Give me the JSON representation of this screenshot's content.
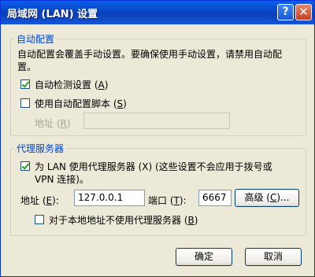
{
  "window": {
    "title": "局域网 (LAN) 设置",
    "help_glyph": "?",
    "close_glyph": "✕"
  },
  "auto_config": {
    "group_label": "自动配置",
    "description_line1": "自动配置会覆盖手动设置。要确保使用手动设置，请禁用自动配",
    "description_line2": "置。",
    "auto_detect": {
      "label": "自动检测设置 (",
      "key": "A",
      "suffix": ")",
      "checked": true
    },
    "use_script": {
      "label": "使用自动配置脚本 (",
      "key": "S",
      "suffix": ")",
      "checked": false
    },
    "address": {
      "label": "地址 (",
      "key": "R",
      "suffix": ")",
      "value": ""
    }
  },
  "proxy": {
    "group_label": "代理服务器",
    "use_proxy": {
      "line1": "为 LAN 使用代理服务器 (X) (这些设置不会应用于拨号或",
      "line2": "VPN 连接)。",
      "checked": true
    },
    "address": {
      "label": "地址 (",
      "key": "E",
      "suffix": "):",
      "value": "127.0.0.1"
    },
    "port": {
      "label": "端口 (",
      "key": "T",
      "suffix": "):",
      "value": "6667"
    },
    "advanced_button": {
      "label": "高级 (",
      "key": "C",
      "suffix": ")..."
    },
    "bypass_local": {
      "label": "对于本地地址不使用代理服务器 (",
      "key": "B",
      "suffix": ")",
      "checked": false
    }
  },
  "buttons": {
    "ok": "确定",
    "cancel": "取消"
  }
}
